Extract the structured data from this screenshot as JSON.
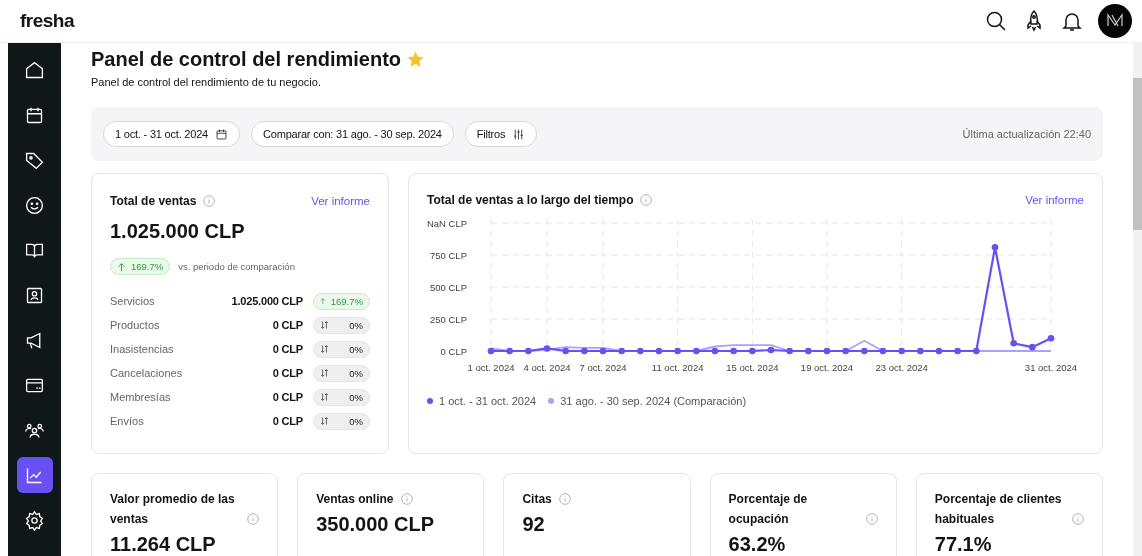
{
  "app": {
    "logo": "fresha"
  },
  "sidebar": {
    "items": [
      {
        "selected": false
      },
      {
        "selected": false
      },
      {
        "selected": false
      },
      {
        "selected": false
      },
      {
        "selected": false
      },
      {
        "selected": false
      },
      {
        "selected": false
      },
      {
        "selected": false
      },
      {
        "selected": false
      },
      {
        "selected": true
      },
      {
        "selected": false
      }
    ]
  },
  "page": {
    "title": "Panel de control del rendimiento",
    "favorite": true,
    "subtitle": "Panel de control del rendimiento de tu negocio."
  },
  "filters": {
    "date_range": "1 oct. - 31 oct. 2024",
    "compare": "Comparar con: 31 ago. - 30 sep. 2024",
    "filters_button": "Filtros",
    "last_updated": "Última actualización 22:40"
  },
  "total_sales": {
    "title": "Total de ventas",
    "link": "Ver informe",
    "value": "1.025.000 CLP",
    "change": "169.7%",
    "kind": "up",
    "change_caption": "vs. periodo de comparación",
    "rows": [
      {
        "label": "Servicios",
        "value": "1.025.000 CLP",
        "change": "169.7%",
        "kind": "up"
      },
      {
        "label": "Productos",
        "value": "0 CLP",
        "change": "0%",
        "kind": "flat"
      },
      {
        "label": "Inasistencias",
        "value": "0 CLP",
        "change": "0%",
        "kind": "flat"
      },
      {
        "label": "Cancelaciones",
        "value": "0 CLP",
        "change": "0%",
        "kind": "flat"
      },
      {
        "label": "Membresías",
        "value": "0 CLP",
        "change": "0%",
        "kind": "flat"
      },
      {
        "label": "Envíos",
        "value": "0 CLP",
        "change": "0%",
        "kind": "flat"
      }
    ]
  },
  "sales_over_time": {
    "title": "Total de ventas a lo largo del tiempo",
    "link": "Ver informe",
    "chart_data": {
      "type": "line",
      "categories": [
        "1 oct. 2024",
        null,
        null,
        "4 oct. 2024",
        null,
        null,
        "7 oct. 2024",
        null,
        null,
        null,
        "11 oct. 2024",
        null,
        null,
        null,
        "15 oct. 2024",
        null,
        null,
        null,
        "19 oct. 2024",
        null,
        null,
        null,
        "23 oct. 2024",
        null,
        null,
        null,
        null,
        null,
        null,
        null,
        "31 oct. 2024"
      ],
      "ylim": [
        0,
        1000
      ],
      "grid": true,
      "legend": true,
      "yticks": [
        {
          "value": 0,
          "label": "0 CLP"
        },
        {
          "value": 250,
          "label": "250 CLP"
        },
        {
          "value": 500,
          "label": "500 CLP"
        },
        {
          "value": 750,
          "label": "750 CLP"
        },
        {
          "value": 1000,
          "label": "NaN CLP"
        }
      ],
      "series": [
        {
          "name": "1 oct. - 31 oct. 2024",
          "color": "#6950f3",
          "marker": true,
          "values": [
            0,
            0,
            0,
            20,
            0,
            0,
            0,
            0,
            0,
            0,
            0,
            0,
            0,
            0,
            0,
            8,
            0,
            0,
            0,
            0,
            0,
            0,
            0,
            0,
            0,
            0,
            0,
            810,
            60,
            30,
            100
          ]
        },
        {
          "name": "31 ago. - 30 sep. 2024 (Comparación)",
          "color": "#a9a2fa",
          "values": [
            20,
            0,
            0,
            10,
            30,
            25,
            25,
            0,
            0,
            0,
            0,
            0,
            35,
            45,
            45,
            45,
            0,
            0,
            0,
            0,
            80,
            0,
            0,
            0,
            0,
            0,
            0,
            0,
            0,
            0,
            0
          ]
        }
      ]
    }
  },
  "metric_cards": [
    {
      "title": "Valor promedio de las ventas",
      "value": "11.264 CLP"
    },
    {
      "title": "Ventas online",
      "value": "350.000 CLP"
    },
    {
      "title": "Citas",
      "value": "92"
    },
    {
      "title": "Porcentaje de ocupación",
      "value": "63.2%"
    },
    {
      "title": "Porcentaje de clientes habituales",
      "value": "77.1%"
    }
  ]
}
